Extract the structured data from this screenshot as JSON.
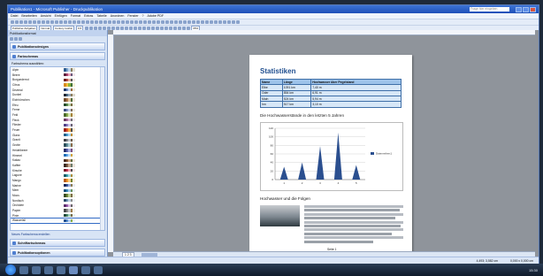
{
  "window": {
    "title": "Publikation1 - Microsoft Publisher - Druckpublikation",
    "search_placeholder": "Frage hier eingeben"
  },
  "menu": [
    "Datei",
    "Bearbeiten",
    "Ansicht",
    "Einfügen",
    "Format",
    "Extras",
    "Tabelle",
    "Anordnen",
    "Fenster",
    "?",
    "Adobe PDF"
  ],
  "toolbar": {
    "task_label": "Publisher-Aufgaben",
    "style": "Normal",
    "font": "Century Gothic",
    "size": "9,5",
    "zoom": "65%"
  },
  "pane": {
    "title": "Publikationsformat",
    "sections": {
      "designs": "Publikationsdesigns",
      "colors": "Farbschemas",
      "fonts": "Schriftartschemas",
      "options": "Publikationsoptionen"
    },
    "subtitle": "Farbschema auswählen:",
    "schemes": [
      {
        "name": "Alpin",
        "swatches": [
          "#2d5c8f",
          "#7aa3cf",
          "#c2d6ec",
          "#8a7f60",
          "#e3e1d4"
        ]
      },
      {
        "name": "Beere",
        "swatches": [
          "#5a1d3b",
          "#b04670",
          "#e8a5bd",
          "#6a5a7a",
          "#f0e4ea"
        ]
      },
      {
        "name": "Burgunderrot",
        "swatches": [
          "#6e1a1a",
          "#b8504a",
          "#e5b0a0",
          "#555",
          "#f2e6e0"
        ]
      },
      {
        "name": "Citrus",
        "swatches": [
          "#d98b1e",
          "#f2c23a",
          "#8db33c",
          "#40703a",
          "#f7f0d6"
        ]
      },
      {
        "name": "Dezimal",
        "swatches": [
          "#203a6b",
          "#6e8cc6",
          "#c9d7ef",
          "#9a6c3a",
          "#efe7da"
        ]
      },
      {
        "name": "Dunkel",
        "swatches": [
          "#1c2733",
          "#4b6a86",
          "#96a8b9",
          "#8c7b5a",
          "#dcd8cf"
        ]
      },
      {
        "name": "Eichhörnchen",
        "swatches": [
          "#704a2a",
          "#b0794b",
          "#e2c6a4",
          "#4d6b3a",
          "#f0e8dc"
        ]
      },
      {
        "name": "Efeu",
        "swatches": [
          "#244a2a",
          "#5b8a4d",
          "#b7d1a4",
          "#7a6840",
          "#eef3e6"
        ]
      },
      {
        "name": "Ferne",
        "swatches": [
          "#3b4d80",
          "#7f90c4",
          "#c8cfe9",
          "#7d6b55",
          "#ece9e2"
        ]
      },
      {
        "name": "Feld",
        "swatches": [
          "#4b6a2a",
          "#8aae4f",
          "#d5e3b2",
          "#a6803a",
          "#f3f0dd"
        ]
      },
      {
        "name": "Fleck",
        "swatches": [
          "#6b3b64",
          "#a76ba0",
          "#dbb8d6",
          "#6f6f6f",
          "#f1e8ef"
        ]
      },
      {
        "name": "Flieder",
        "swatches": [
          "#4f3f86",
          "#8c7fc2",
          "#cfc9ea",
          "#6a6070",
          "#efecf6"
        ]
      },
      {
        "name": "Feuer",
        "swatches": [
          "#9a1e12",
          "#e2572a",
          "#f6b04a",
          "#4d4d4d",
          "#fbe8d2"
        ]
      },
      {
        "name": "Glanz",
        "swatches": [
          "#1f5f8a",
          "#4aa0d0",
          "#a7d6f0",
          "#c08a2e",
          "#eef6fb"
        ]
      },
      {
        "name": "Granit",
        "swatches": [
          "#3d3f44",
          "#80858e",
          "#c2c6cc",
          "#6a5a47",
          "#ebebea"
        ]
      },
      {
        "name": "Grotte",
        "swatches": [
          "#2c4f5a",
          "#5f8f99",
          "#acccd1",
          "#8a6b4a",
          "#e7efef"
        ]
      },
      {
        "name": "Heidelbeere",
        "swatches": [
          "#2a2f6a",
          "#5d66b3",
          "#aab0e0",
          "#7a4f7d",
          "#ebecf7"
        ]
      },
      {
        "name": "Himmel",
        "swatches": [
          "#1e6db5",
          "#60a6e6",
          "#b9dbf7",
          "#d3a23a",
          "#f0f7fd"
        ]
      },
      {
        "name": "Kakao",
        "swatches": [
          "#4a2c1c",
          "#8b5a3a",
          "#cfa98a",
          "#5f6b3f",
          "#efe5da"
        ]
      },
      {
        "name": "Kaffee",
        "swatches": [
          "#3b2a20",
          "#7b5b44",
          "#c4a98f",
          "#6b7a6a",
          "#ece4db"
        ]
      },
      {
        "name": "Kirsche",
        "swatches": [
          "#7a0f26",
          "#c23b56",
          "#eda3b1",
          "#4c4c4c",
          "#f6e3e7"
        ]
      },
      {
        "name": "Lagune",
        "swatches": [
          "#0f5c66",
          "#3fa2ad",
          "#a5dbe0",
          "#b08a3a",
          "#e8f5f6"
        ]
      },
      {
        "name": "Mango",
        "swatches": [
          "#b85a10",
          "#f0962a",
          "#fbd08a",
          "#6f7f2e",
          "#fdf0dd"
        ]
      },
      {
        "name": "Marine",
        "swatches": [
          "#14285a",
          "#3d5aa0",
          "#9cb0dc",
          "#8c7a50",
          "#e7ebf4"
        ]
      },
      {
        "name": "Meer",
        "swatches": [
          "#12507a",
          "#3e8cbf",
          "#a5cbe6",
          "#6a8f5a",
          "#e7f1f8"
        ]
      },
      {
        "name": "Moos",
        "swatches": [
          "#3a4d1e",
          "#6f8a3a",
          "#bcd096",
          "#7b6a45",
          "#eef1e2"
        ]
      },
      {
        "name": "Nordisch",
        "swatches": [
          "#2b4a6b",
          "#6f93b6",
          "#bfd1e2",
          "#8c8c8c",
          "#eef2f6"
        ]
      },
      {
        "name": "Orchidee",
        "swatches": [
          "#5b2b6b",
          "#9c5fb0",
          "#d8bde2",
          "#6a6a6a",
          "#f3ebf6"
        ]
      },
      {
        "name": "Papier",
        "swatches": [
          "#4a4a4a",
          "#8a8a8a",
          "#c8c8c8",
          "#9a7a4a",
          "#f5f2ea"
        ]
      },
      {
        "name": "Pinie",
        "swatches": [
          "#1f4a3a",
          "#4d8a6e",
          "#a8d1bd",
          "#7a6a4a",
          "#e9f3ee"
        ]
      },
      {
        "name": "Wasserfall",
        "swatches": [
          "#1d4f8f",
          "#5b8fd0",
          "#b5d0ef",
          "#8ab04a",
          "#eef4fb"
        ]
      }
    ],
    "selected_scheme": "Wasserfall",
    "create_link": "Neues Farbschema erstellen"
  },
  "document": {
    "heading": "Statistiken",
    "table": {
      "headers": [
        "Name",
        "Länge",
        "Hochwasser über Pegelstand"
      ],
      "rows": [
        [
          "Elbe",
          "1091 km",
          "7,40 m"
        ],
        [
          "Oder",
          "854 km",
          "6,91 m"
        ],
        [
          "Main",
          "524 km",
          "5,94 m"
        ],
        [
          "Inn",
          "517 km",
          "3,10 m"
        ]
      ]
    },
    "chart_caption": "Die Hochwasserstände in den letzten 5 Jahren",
    "section_heading": "Hochwasser und die Folgen",
    "page_number": "Seite 1"
  },
  "pages": {
    "tabs": "1  2  3"
  },
  "status": {
    "position": "4,493; 3,582 cm",
    "size": "0,000 x 0,000 cm"
  },
  "taskbar": {
    "time": "15:30"
  },
  "chart_data": {
    "type": "area",
    "categories": [
      "1",
      "2",
      "3",
      "4",
      "5"
    ],
    "series": [
      {
        "name": "Datenreihen1",
        "values": [
          30,
          40,
          78,
          110,
          34
        ]
      }
    ],
    "ylim": [
      0,
      120
    ],
    "yticks": [
      0,
      20,
      40,
      60,
      80,
      100,
      120
    ],
    "legend": "right",
    "grid": true,
    "color": "#2b4f8f"
  }
}
